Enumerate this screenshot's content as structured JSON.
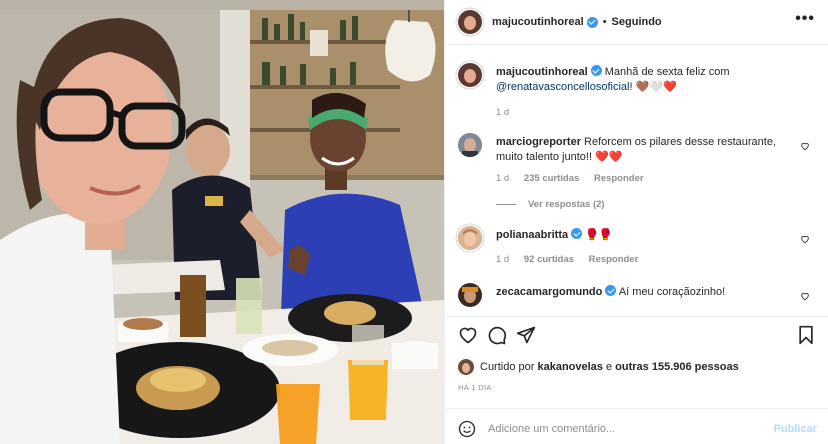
{
  "post": {
    "author": "majucoutinhoreal",
    "follow_label": "Seguindo",
    "more_label": "•••",
    "caption": {
      "username": "majucoutinhoreal",
      "text": "Manhã de sexta feliz com",
      "mention": "@renatavasconcellosoficial",
      "emoji": "! 🤎🤍❤️",
      "time": "1 d"
    },
    "comments": [
      {
        "username": "marciogreporter",
        "verified": false,
        "text": "Reforcem os pilares desse restaurante, muito talento junto!! ❤️❤️",
        "time": "1 d",
        "likes": "235 curtidas",
        "reply_label": "Responder",
        "replies_label": "Ver respostas (2)"
      },
      {
        "username": "polianaabritta",
        "verified": true,
        "text": "🥊🥊",
        "time": "1 d",
        "likes": "92 curtidas",
        "reply_label": "Responder"
      },
      {
        "username": "zecacamargomundo",
        "verified": true,
        "text": "Aí meu coraçãozinho!"
      }
    ],
    "liked_by": {
      "prefix": "Curtido por",
      "user": "kakanovelas",
      "conj": "e",
      "others": "outras 155.906 pessoas"
    },
    "posted_ago": "HÁ 1 DIA",
    "add_comment_placeholder": "Adicione um comentário...",
    "publish_label": "Publicar"
  },
  "icons": {
    "like": "heart-icon",
    "comment": "comment-icon",
    "share": "paper-plane-icon",
    "save": "bookmark-icon",
    "emoji": "smiley-icon",
    "more": "more-horizontal-icon"
  },
  "colors": {
    "verified": "#3897f0",
    "link": "#00376b",
    "muted": "#8e8e8e",
    "publish_disabled": "#b3dbff",
    "border": "#efefef"
  }
}
